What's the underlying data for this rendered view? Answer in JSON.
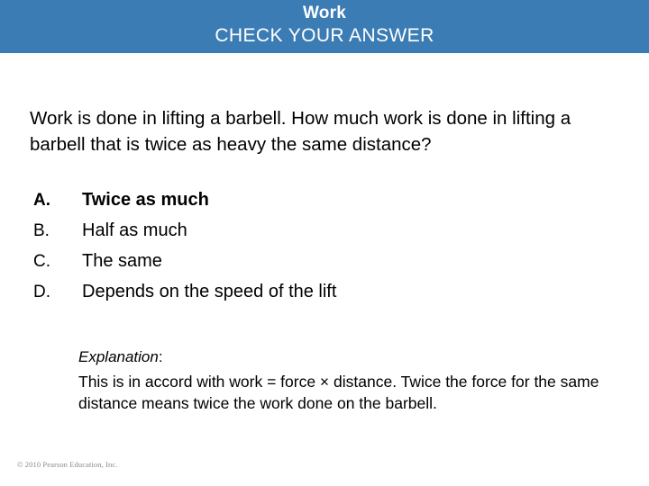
{
  "header": {
    "title": "Work",
    "subtitle": "CHECK YOUR ANSWER",
    "background_color": "#3c7cb4",
    "text_color": "#ffffff"
  },
  "question": {
    "text": "Work is done in lifting a barbell. How much work is done in lifting a barbell that is twice as heavy the same distance?"
  },
  "choices": [
    {
      "letter": "A.",
      "text": "Twice as much",
      "correct": true
    },
    {
      "letter": "B.",
      "text": "Half as much",
      "correct": false
    },
    {
      "letter": "C.",
      "text": "The same",
      "correct": false
    },
    {
      "letter": "D.",
      "text": "Depends on the speed of the lift",
      "correct": false
    }
  ],
  "explanation": {
    "label": "Explanation",
    "colon": ":",
    "body": "This is in accord with work = force × distance. Twice the force for the same distance means twice the work done on the barbell."
  },
  "footer": {
    "copyright": "© 2010 Pearson Education, Inc."
  }
}
